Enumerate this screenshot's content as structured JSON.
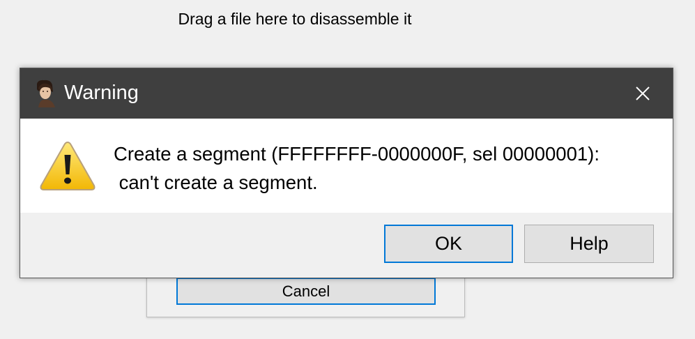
{
  "background": {
    "drop_hint": "Drag a file here to disassemble it",
    "cancel_label": "Cancel"
  },
  "dialog": {
    "title": "Warning",
    "app_icon": "portrait-icon",
    "warning_icon": "warning-triangle-icon",
    "message_line1": "Create a segment (FFFFFFFF-0000000F, sel 00000001):",
    "message_line2": " can't create a segment.",
    "ok_label": "OK",
    "help_label": "Help",
    "close_icon": "close-icon"
  },
  "colors": {
    "titlebar": "#3f3f3f",
    "accent": "#0078d7",
    "warning_yellow": "#f5c518"
  }
}
